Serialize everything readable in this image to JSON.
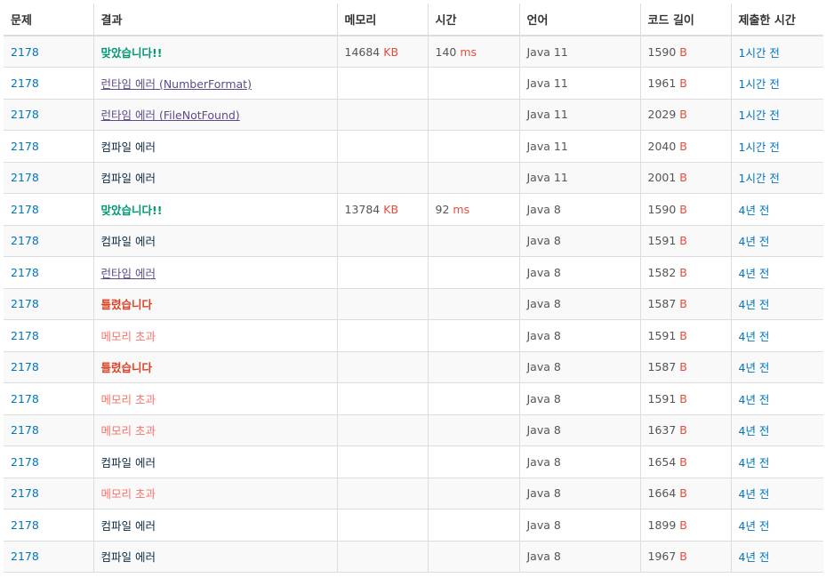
{
  "headers": {
    "problem": "문제",
    "result": "결과",
    "memory": "메모리",
    "time": "시간",
    "language": "언어",
    "code_length": "코드 길이",
    "submitted": "제출한 시간"
  },
  "units": {
    "memory": "KB",
    "time": "ms",
    "length": "B"
  },
  "colors": {
    "accepted": "#009874",
    "wrong": "#dd4124",
    "compile_error": "#0b2945",
    "runtime_error": "#5f4b8b",
    "memory_limit": "#fa7268",
    "link": "#0076c0",
    "unit": "#e74c3c"
  },
  "rows": [
    {
      "problem": "2178",
      "result": "맞았습니다!!",
      "result_type": "ac",
      "memory": "14684",
      "time": "140",
      "language": "Java 11",
      "length": "1590",
      "submitted": "1시간 전"
    },
    {
      "problem": "2178",
      "result": "런타임 에러 (NumberFormat)",
      "result_type": "re",
      "memory": "",
      "time": "",
      "language": "Java 11",
      "length": "1961",
      "submitted": "1시간 전"
    },
    {
      "problem": "2178",
      "result": "런타임 에러 (FileNotFound)",
      "result_type": "re",
      "memory": "",
      "time": "",
      "language": "Java 11",
      "length": "2029",
      "submitted": "1시간 전"
    },
    {
      "problem": "2178",
      "result": "컴파일 에러",
      "result_type": "ce",
      "memory": "",
      "time": "",
      "language": "Java 11",
      "length": "2040",
      "submitted": "1시간 전"
    },
    {
      "problem": "2178",
      "result": "컴파일 에러",
      "result_type": "ce",
      "memory": "",
      "time": "",
      "language": "Java 11",
      "length": "2001",
      "submitted": "1시간 전"
    },
    {
      "problem": "2178",
      "result": "맞았습니다!!",
      "result_type": "ac",
      "memory": "13784",
      "time": "92",
      "language": "Java 8",
      "length": "1590",
      "submitted": "4년 전"
    },
    {
      "problem": "2178",
      "result": "컴파일 에러",
      "result_type": "ce",
      "memory": "",
      "time": "",
      "language": "Java 8",
      "length": "1591",
      "submitted": "4년 전"
    },
    {
      "problem": "2178",
      "result": "런타임 에러",
      "result_type": "re",
      "memory": "",
      "time": "",
      "language": "Java 8",
      "length": "1582",
      "submitted": "4년 전"
    },
    {
      "problem": "2178",
      "result": "틀렸습니다",
      "result_type": "wa",
      "memory": "",
      "time": "",
      "language": "Java 8",
      "length": "1587",
      "submitted": "4년 전"
    },
    {
      "problem": "2178",
      "result": "메모리 초과",
      "result_type": "mle",
      "memory": "",
      "time": "",
      "language": "Java 8",
      "length": "1591",
      "submitted": "4년 전"
    },
    {
      "problem": "2178",
      "result": "틀렸습니다",
      "result_type": "wa",
      "memory": "",
      "time": "",
      "language": "Java 8",
      "length": "1587",
      "submitted": "4년 전"
    },
    {
      "problem": "2178",
      "result": "메모리 초과",
      "result_type": "mle",
      "memory": "",
      "time": "",
      "language": "Java 8",
      "length": "1591",
      "submitted": "4년 전"
    },
    {
      "problem": "2178",
      "result": "메모리 초과",
      "result_type": "mle",
      "memory": "",
      "time": "",
      "language": "Java 8",
      "length": "1637",
      "submitted": "4년 전"
    },
    {
      "problem": "2178",
      "result": "컴파일 에러",
      "result_type": "ce",
      "memory": "",
      "time": "",
      "language": "Java 8",
      "length": "1654",
      "submitted": "4년 전"
    },
    {
      "problem": "2178",
      "result": "메모리 초과",
      "result_type": "mle",
      "memory": "",
      "time": "",
      "language": "Java 8",
      "length": "1664",
      "submitted": "4년 전"
    },
    {
      "problem": "2178",
      "result": "컴파일 에러",
      "result_type": "ce",
      "memory": "",
      "time": "",
      "language": "Java 8",
      "length": "1899",
      "submitted": "4년 전"
    },
    {
      "problem": "2178",
      "result": "컴파일 에러",
      "result_type": "ce",
      "memory": "",
      "time": "",
      "language": "Java 8",
      "length": "1967",
      "submitted": "4년 전"
    }
  ]
}
